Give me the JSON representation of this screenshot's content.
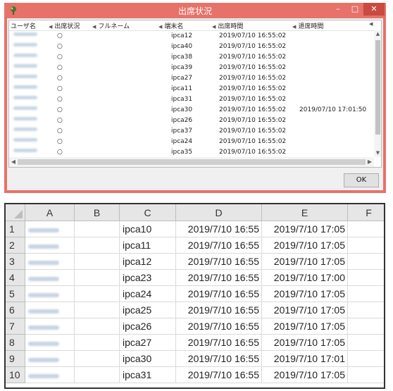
{
  "window": {
    "title": "出席状況",
    "controls": {
      "minimize": "–",
      "maximize": "□",
      "close": "✕"
    },
    "columns": [
      "ユーザ名",
      "出席状況",
      "フルネーム",
      "端末名",
      "出席時間",
      "退席時間"
    ],
    "rows": [
      {
        "status": "○",
        "terminal": "ipca12",
        "in_time": "2019/07/10 16:55:02",
        "out_time": ""
      },
      {
        "status": "○",
        "terminal": "ipca40",
        "in_time": "2019/07/10 16:55:02",
        "out_time": ""
      },
      {
        "status": "○",
        "terminal": "ipca38",
        "in_time": "2019/07/10 16:55:02",
        "out_time": ""
      },
      {
        "status": "○",
        "terminal": "ipca39",
        "in_time": "2019/07/10 16:55:02",
        "out_time": ""
      },
      {
        "status": "○",
        "terminal": "ipca27",
        "in_time": "2019/07/10 16:55:02",
        "out_time": ""
      },
      {
        "status": "○",
        "terminal": "ipca11",
        "in_time": "2019/07/10 16:55:02",
        "out_time": ""
      },
      {
        "status": "○",
        "terminal": "ipca31",
        "in_time": "2019/07/10 16:55:02",
        "out_time": ""
      },
      {
        "status": "○",
        "terminal": "ipca30",
        "in_time": "2019/07/10 16:55:02",
        "out_time": "2019/07/10 17:01:50"
      },
      {
        "status": "○",
        "terminal": "ipca26",
        "in_time": "2019/07/10 16:55:02",
        "out_time": ""
      },
      {
        "status": "○",
        "terminal": "ipca37",
        "in_time": "2019/07/10 16:55:02",
        "out_time": ""
      },
      {
        "status": "○",
        "terminal": "ipca24",
        "in_time": "2019/07/10 16:55:02",
        "out_time": ""
      },
      {
        "status": "○",
        "terminal": "ipca35",
        "in_time": "2019/07/10 16:55:02",
        "out_time": ""
      }
    ],
    "ok_label": "OK"
  },
  "sheet": {
    "columns": [
      "A",
      "B",
      "C",
      "D",
      "E",
      "F"
    ],
    "rows": [
      {
        "num": "1",
        "c": "ipca10",
        "d": "2019/7/10 16:55",
        "e": "2019/7/10 17:05"
      },
      {
        "num": "2",
        "c": "ipca11",
        "d": "2019/7/10 16:55",
        "e": "2019/7/10 17:05"
      },
      {
        "num": "3",
        "c": "ipca12",
        "d": "2019/7/10 16:55",
        "e": "2019/7/10 17:05"
      },
      {
        "num": "4",
        "c": "ipca23",
        "d": "2019/7/10 16:55",
        "e": "2019/7/10 17:00"
      },
      {
        "num": "5",
        "c": "ipca24",
        "d": "2019/7/10 16:55",
        "e": "2019/7/10 17:05"
      },
      {
        "num": "6",
        "c": "ipca25",
        "d": "2019/7/10 16:55",
        "e": "2019/7/10 17:05"
      },
      {
        "num": "7",
        "c": "ipca26",
        "d": "2019/7/10 16:55",
        "e": "2019/7/10 17:05"
      },
      {
        "num": "8",
        "c": "ipca27",
        "d": "2019/7/10 16:55",
        "e": "2019/7/10 17:05"
      },
      {
        "num": "9",
        "c": "ipca30",
        "d": "2019/7/10 16:55",
        "e": "2019/7/10 17:01"
      },
      {
        "num": "10",
        "c": "ipca31",
        "d": "2019/7/10 16:55",
        "e": "2019/7/10 17:05"
      }
    ]
  },
  "colors": {
    "titlebar": "#e6726a",
    "close": "#c94a40",
    "grid": "#dadada",
    "header": "#e6e6e6"
  }
}
